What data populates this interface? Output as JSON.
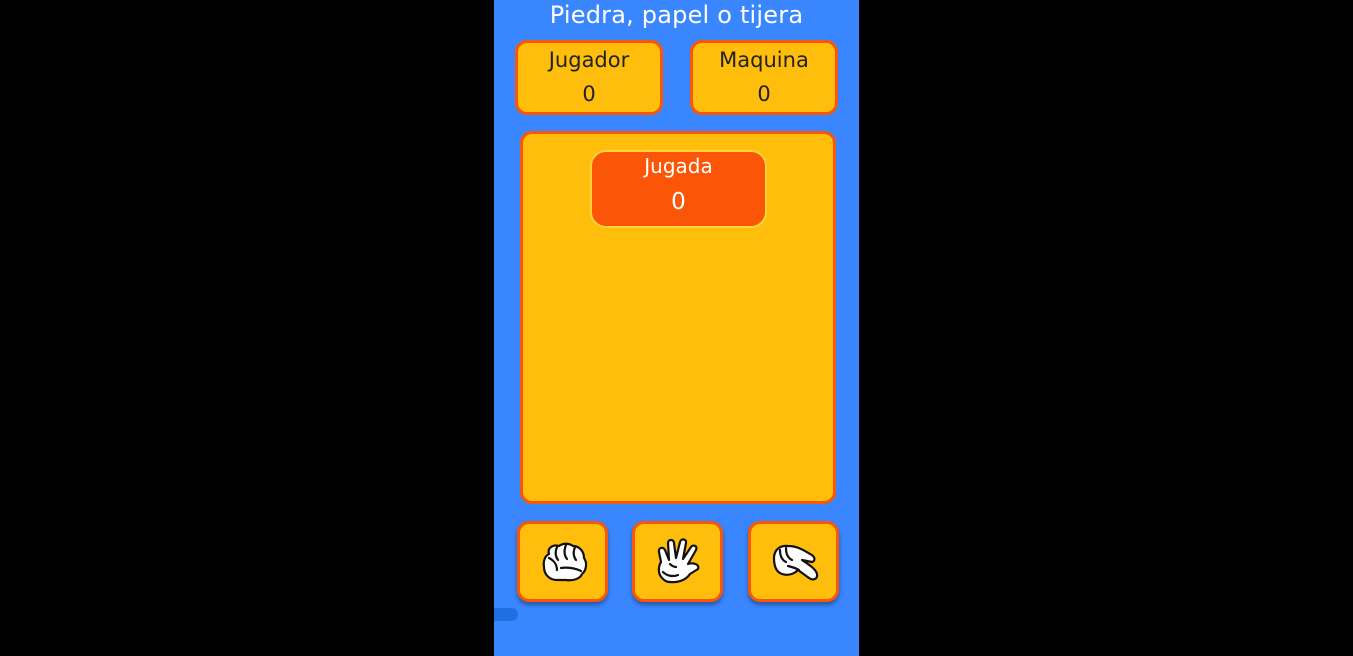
{
  "app": {
    "title": "Piedra, papel o tijera"
  },
  "scores": {
    "player": {
      "label": "Jugador",
      "value": "0"
    },
    "machine": {
      "label": "Maquina",
      "value": "0"
    }
  },
  "play": {
    "label": "Jugada",
    "value": "0"
  },
  "choices": [
    {
      "name": "rock",
      "icon": "rock-hand-icon"
    },
    {
      "name": "paper",
      "icon": "paper-hand-icon"
    },
    {
      "name": "scissors",
      "icon": "scissors-hand-icon"
    }
  ],
  "colors": {
    "background": "#3a86ff",
    "card": "#ffbe0b",
    "accent": "#fb5607",
    "text_light": "#ffffff",
    "text_dark": "#222222"
  }
}
